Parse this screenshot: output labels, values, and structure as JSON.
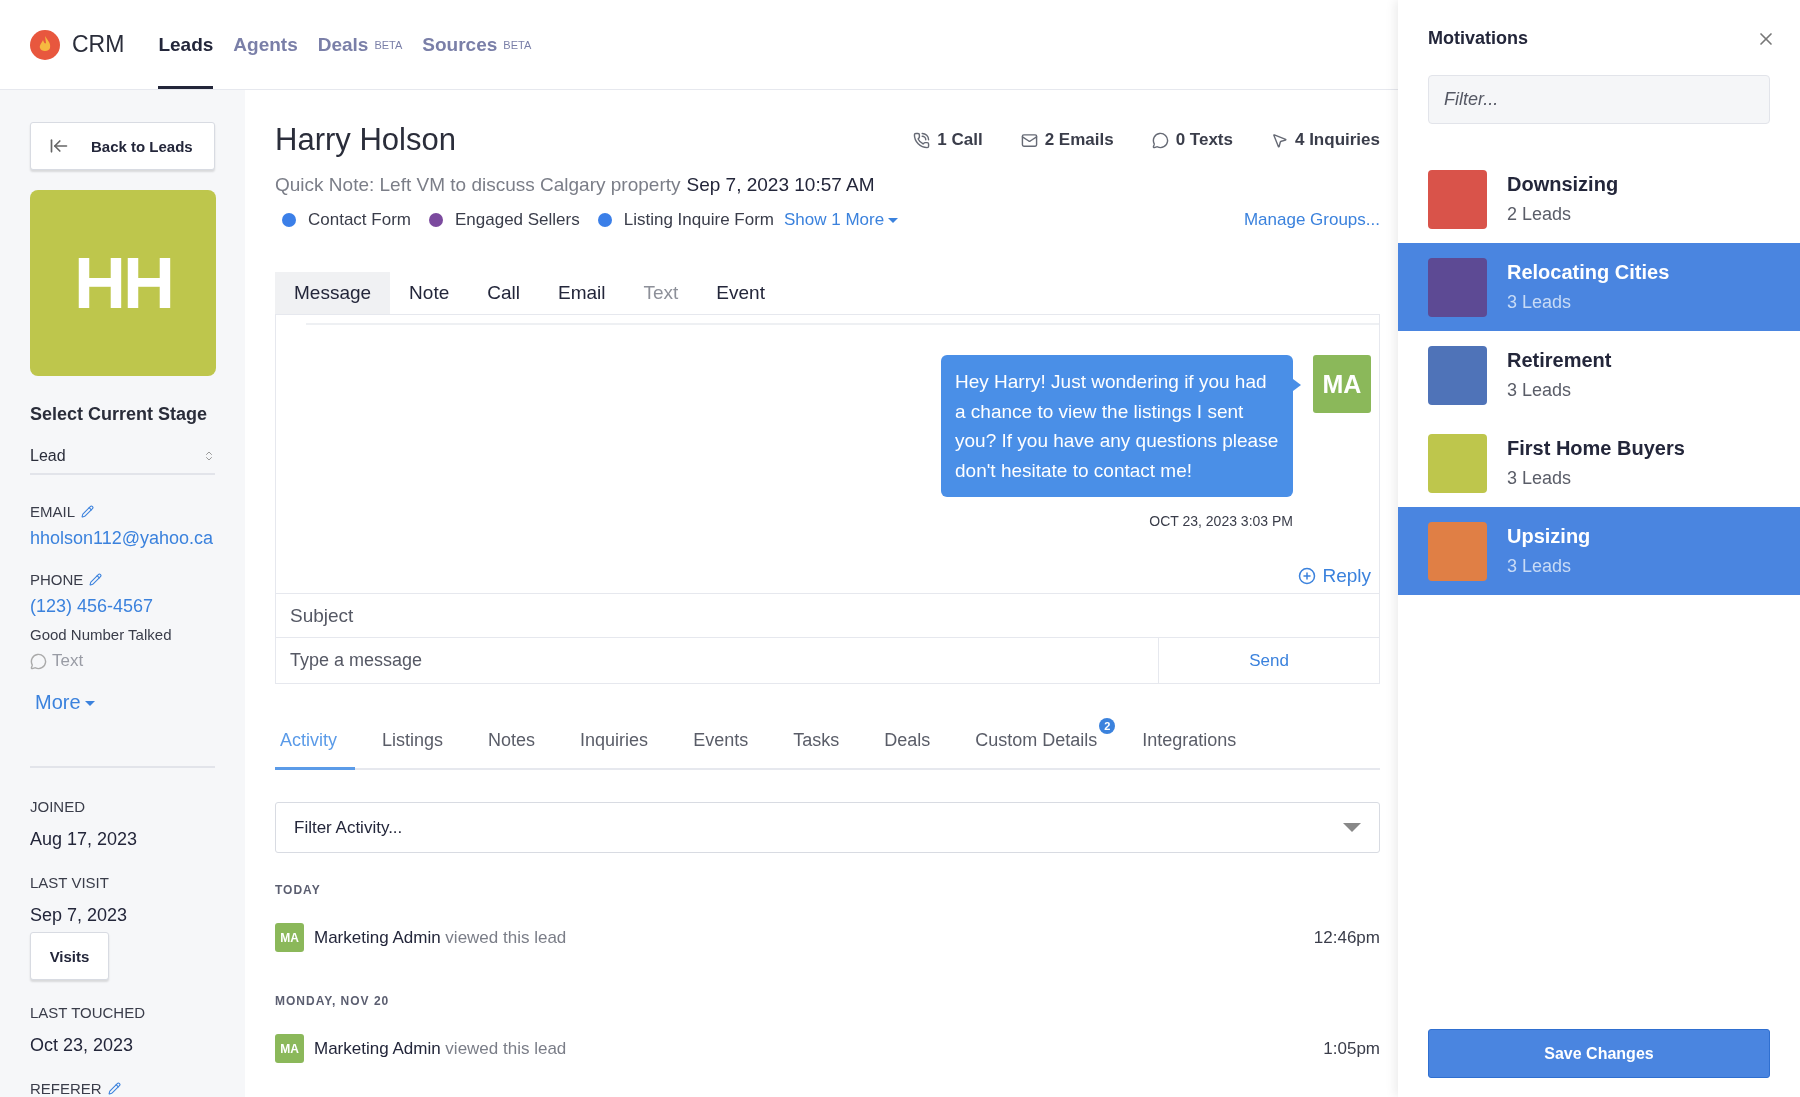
{
  "nav": {
    "brand": "CRM",
    "tabs": [
      {
        "label": "Leads",
        "selected": true
      },
      {
        "label": "Agents",
        "selected": false
      },
      {
        "label": "Deals",
        "badge": "BETA",
        "selected": false
      },
      {
        "label": "Sources",
        "badge": "BETA",
        "selected": false
      }
    ]
  },
  "sidebar": {
    "back_button": "Back to Leads",
    "avatar_initials": "HH",
    "stage": {
      "label": "Select Current Stage",
      "value": "Lead"
    },
    "email": {
      "label": "EMAIL",
      "value": "hholson112@yahoo.ca"
    },
    "phone": {
      "label": "PHONE",
      "value": "(123) 456-4567",
      "status": "Good Number Talked",
      "text_link": "Text"
    },
    "more_link": "More",
    "dates": [
      {
        "label": "JOINED",
        "value": "Aug 17, 2023"
      },
      {
        "label": "LAST VISIT",
        "value": "Sep 7, 2023",
        "button": "Visits"
      },
      {
        "label": "LAST TOUCHED",
        "value": "Oct 23, 2023"
      }
    ],
    "referer_label": "REFERER"
  },
  "lead": {
    "name": "Harry Holson",
    "stats": [
      {
        "kind": "call",
        "label": "1 Call"
      },
      {
        "kind": "email",
        "label": "2 Emails"
      },
      {
        "kind": "text",
        "label": "0 Texts"
      },
      {
        "kind": "inquiry",
        "label": "4 Inquiries"
      }
    ],
    "quick_note": "Quick Note: Left VM to discuss Calgary property",
    "quick_note_date": "Sep 7, 2023 10:57 AM",
    "groups": [
      {
        "label": "Contact Form",
        "color": "#3b7fe8"
      },
      {
        "label": "Engaged Sellers",
        "color": "#7b4a9e"
      },
      {
        "label": "Listing Inquire Form",
        "color": "#3b7fe8"
      }
    ],
    "show_more": "Show 1 More",
    "manage_groups": "Manage Groups..."
  },
  "composer": {
    "tabs": [
      {
        "label": "Message",
        "selected": true,
        "disabled": false
      },
      {
        "label": "Note",
        "selected": false,
        "disabled": false
      },
      {
        "label": "Call",
        "selected": false,
        "disabled": false
      },
      {
        "label": "Email",
        "selected": false,
        "disabled": false
      },
      {
        "label": "Text",
        "selected": false,
        "disabled": true
      },
      {
        "label": "Event",
        "selected": false,
        "disabled": false
      }
    ],
    "message": {
      "text": "Hey Harry! Just wondering if you had a chance to view the listings I sent you? If you have any questions please don't hesitate to contact me!",
      "sender_initials": "MA",
      "timestamp": "OCT 23, 2023 3:03 PM"
    },
    "reply": "Reply",
    "subject_placeholder": "Subject",
    "message_placeholder": "Type a message",
    "send": "Send"
  },
  "activity": {
    "tabs": [
      {
        "label": "Activity",
        "selected": true
      },
      {
        "label": "Listings",
        "selected": false
      },
      {
        "label": "Notes",
        "selected": false
      },
      {
        "label": "Inquiries",
        "selected": false
      },
      {
        "label": "Events",
        "selected": false
      },
      {
        "label": "Tasks",
        "selected": false
      },
      {
        "label": "Deals",
        "selected": false
      },
      {
        "label": "Custom Details",
        "badge": "2",
        "selected": false
      },
      {
        "label": "Integrations",
        "selected": false
      }
    ],
    "filter_placeholder": "Filter Activity...",
    "days": [
      {
        "heading": "TODAY",
        "items": [
          {
            "initials": "MA",
            "actor": "Marketing Admin",
            "action": "viewed this lead",
            "time": "12:46pm"
          }
        ]
      },
      {
        "heading": "MONDAY, NOV 20",
        "items": [
          {
            "initials": "MA",
            "actor": "Marketing Admin",
            "action": "viewed this lead",
            "time": "1:05pm"
          }
        ]
      }
    ]
  },
  "motivations": {
    "title": "Motivations",
    "filter_placeholder": "Filter...",
    "items": [
      {
        "name": "Downsizing",
        "count": "2 Leads",
        "color": "#d9534a",
        "selected": false
      },
      {
        "name": "Relocating Cities",
        "count": "3 Leads",
        "color": "#5d4a94",
        "selected": true
      },
      {
        "name": "Retirement",
        "count": "3 Leads",
        "color": "#4f73b8",
        "selected": false
      },
      {
        "name": "First Home Buyers",
        "count": "3 Leads",
        "color": "#bec64c",
        "selected": false
      },
      {
        "name": "Upsizing",
        "count": "3 Leads",
        "color": "#e07f45",
        "selected": true
      }
    ],
    "save_button": "Save Changes"
  }
}
